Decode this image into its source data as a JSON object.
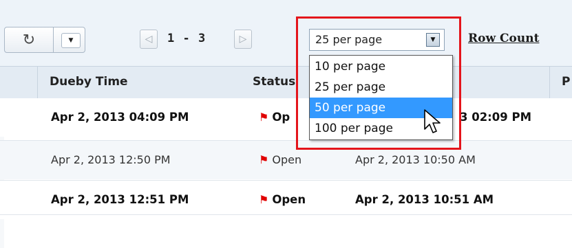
{
  "toolbar": {
    "refresh_icon": "refresh-icon",
    "menu_caret_icon": "caret-down-icon",
    "prev_icon": "arrow-left-icon",
    "next_icon": "arrow-right-icon",
    "range": "1 - 3",
    "per_page_selected": "25 per page",
    "row_count_label": "Row Count"
  },
  "dropdown": {
    "options": [
      "10 per page",
      "25 per page",
      "50 per page",
      "100 per page"
    ],
    "hovered_index": 2
  },
  "table": {
    "headers": [
      "Dueby Time",
      "Status",
      "P"
    ],
    "rows": [
      {
        "dueby": "Apr 2, 2013 04:09 PM",
        "status": "Op",
        "time": "3 02:09 PM",
        "bold": true
      },
      {
        "dueby": "Apr 2, 2013 12:50 PM",
        "status": "Open",
        "time": "Apr 2, 2013 10:50 AM",
        "bold": false
      },
      {
        "dueby": "Apr 2, 2013 12:51 PM",
        "status": "Open",
        "time": "Apr 2, 2013 10:51 AM",
        "bold": true
      }
    ]
  },
  "colors": {
    "highlight_border": "#e4141b",
    "selected_option": "#3399ff",
    "flag": "#e00000"
  }
}
